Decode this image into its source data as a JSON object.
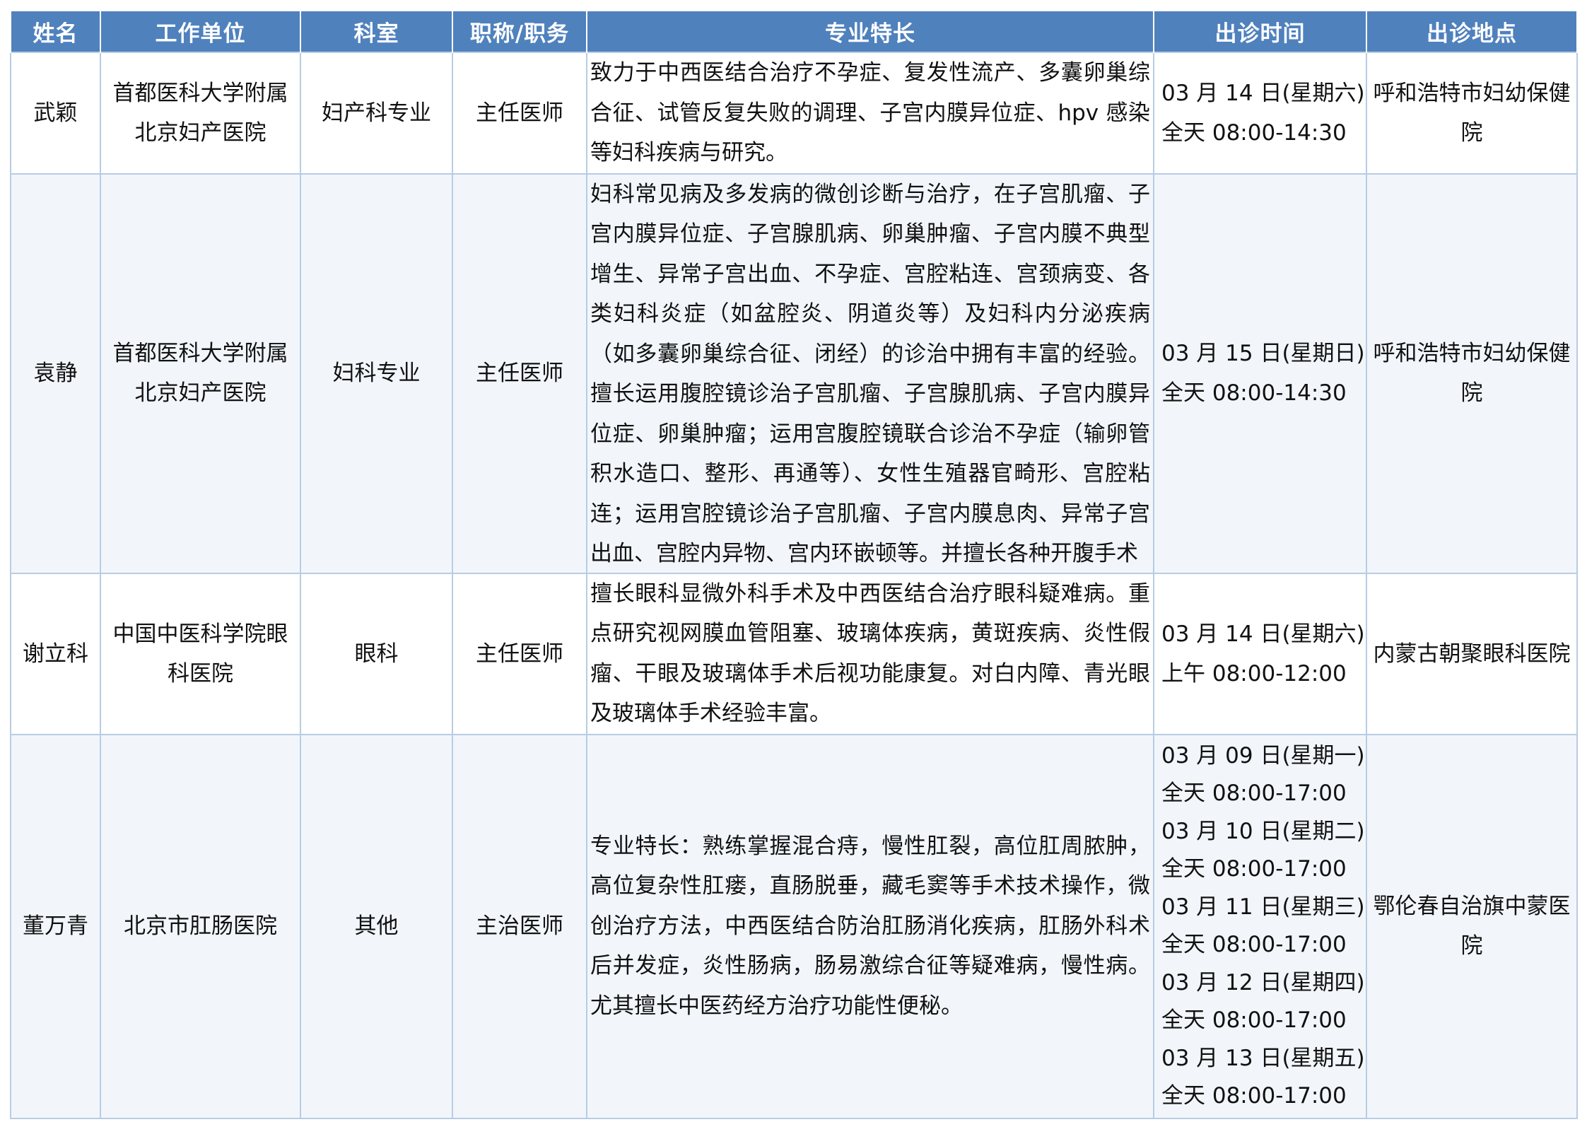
{
  "table": {
    "headers": [
      "姓名",
      "工作单位",
      "科室",
      "职称/职务",
      "专业特长",
      "出诊时间",
      "出诊地点"
    ],
    "rows": [
      {
        "name": "武颖",
        "hospital": "首都医科大学附属北京妇产医院",
        "department": "妇产科专业",
        "title": "主任医师",
        "specialty": "致力于中西医结合治疗不孕症、复发性流产、多囊卵巢综合征、试管反复失败的调理、子宫内膜异位症、hpv 感染等妇科疾病与研究。",
        "schedule": [
          "03 月 14 日(星期六)",
          "全天 08:00-14:30"
        ],
        "location": "呼和浩特市妇幼保健院"
      },
      {
        "name": "袁静",
        "hospital": "首都医科大学附属北京妇产医院",
        "department": "妇科专业",
        "title": "主任医师",
        "specialty": "妇科常见病及多发病的微创诊断与治疗，在子宫肌瘤、子宫内膜异位症、子宫腺肌病、卵巢肿瘤、子宫内膜不典型增生、异常子宫出血、不孕症、宫腔粘连、宫颈病变、各类妇科炎症（如盆腔炎、阴道炎等）及妇科内分泌疾病（如多囊卵巢综合征、闭经）的诊治中拥有丰富的经验。擅长运用腹腔镜诊治子宫肌瘤、子宫腺肌病、子宫内膜异位症、卵巢肿瘤；运用宫腹腔镜联合诊治不孕症（输卵管积水造口、整形、再通等）、女性生殖器官畸形、宫腔粘连；运用宫腔镜诊治子宫肌瘤、子宫内膜息肉、异常子宫出血、宫腔内异物、宫内环嵌顿等。并擅长各种开腹手术",
        "schedule": [
          "03 月 15 日(星期日)",
          "全天 08:00-14:30"
        ],
        "location": "呼和浩特市妇幼保健院"
      },
      {
        "name": "谢立科",
        "hospital": "中国中医科学院眼科医院",
        "department": "眼科",
        "title": "主任医师",
        "specialty": "擅长眼科显微外科手术及中西医结合治疗眼科疑难病。重点研究视网膜血管阻塞、玻璃体疾病，黄斑疾病、炎性假瘤、干眼及玻璃体手术后视功能康复。对白内障、青光眼及玻璃体手术经验丰富。",
        "schedule": [
          "03 月 14 日(星期六)",
          "上午 08:00-12:00"
        ],
        "location": "内蒙古朝聚眼科医院"
      },
      {
        "name": "董万青",
        "hospital": "北京市肛肠医院",
        "department": "其他",
        "title": "主治医师",
        "specialty": "专业特长：熟练掌握混合痔，慢性肛裂，高位肛周脓肿，高位复杂性肛瘘，直肠脱垂，藏毛窦等手术技术操作，微创治疗方法，中西医结合防治肛肠消化疾病，肛肠外科术后并发症，炎性肠病，肠易激综合征等疑难病，慢性病。尤其擅长中医药经方治疗功能性便秘。",
        "schedule": [
          "03 月 09 日(星期一)",
          "全天 08:00-17:00",
          "03 月 10 日(星期二)",
          "全天 08:00-17:00",
          "03 月 11 日(星期三)",
          "全天 08:00-17:00",
          "03 月 12 日(星期四)",
          "全天 08:00-17:00",
          "03 月 13 日(星期五)",
          "全天 08:00-17:00"
        ],
        "location": "鄂伦春自治旗中蒙医院"
      }
    ]
  },
  "colors": {
    "header_bg": "#4f81bd",
    "header_text": "#ffffff",
    "border": "#b8cce4",
    "zebra_bg": "#f2f6fb"
  }
}
